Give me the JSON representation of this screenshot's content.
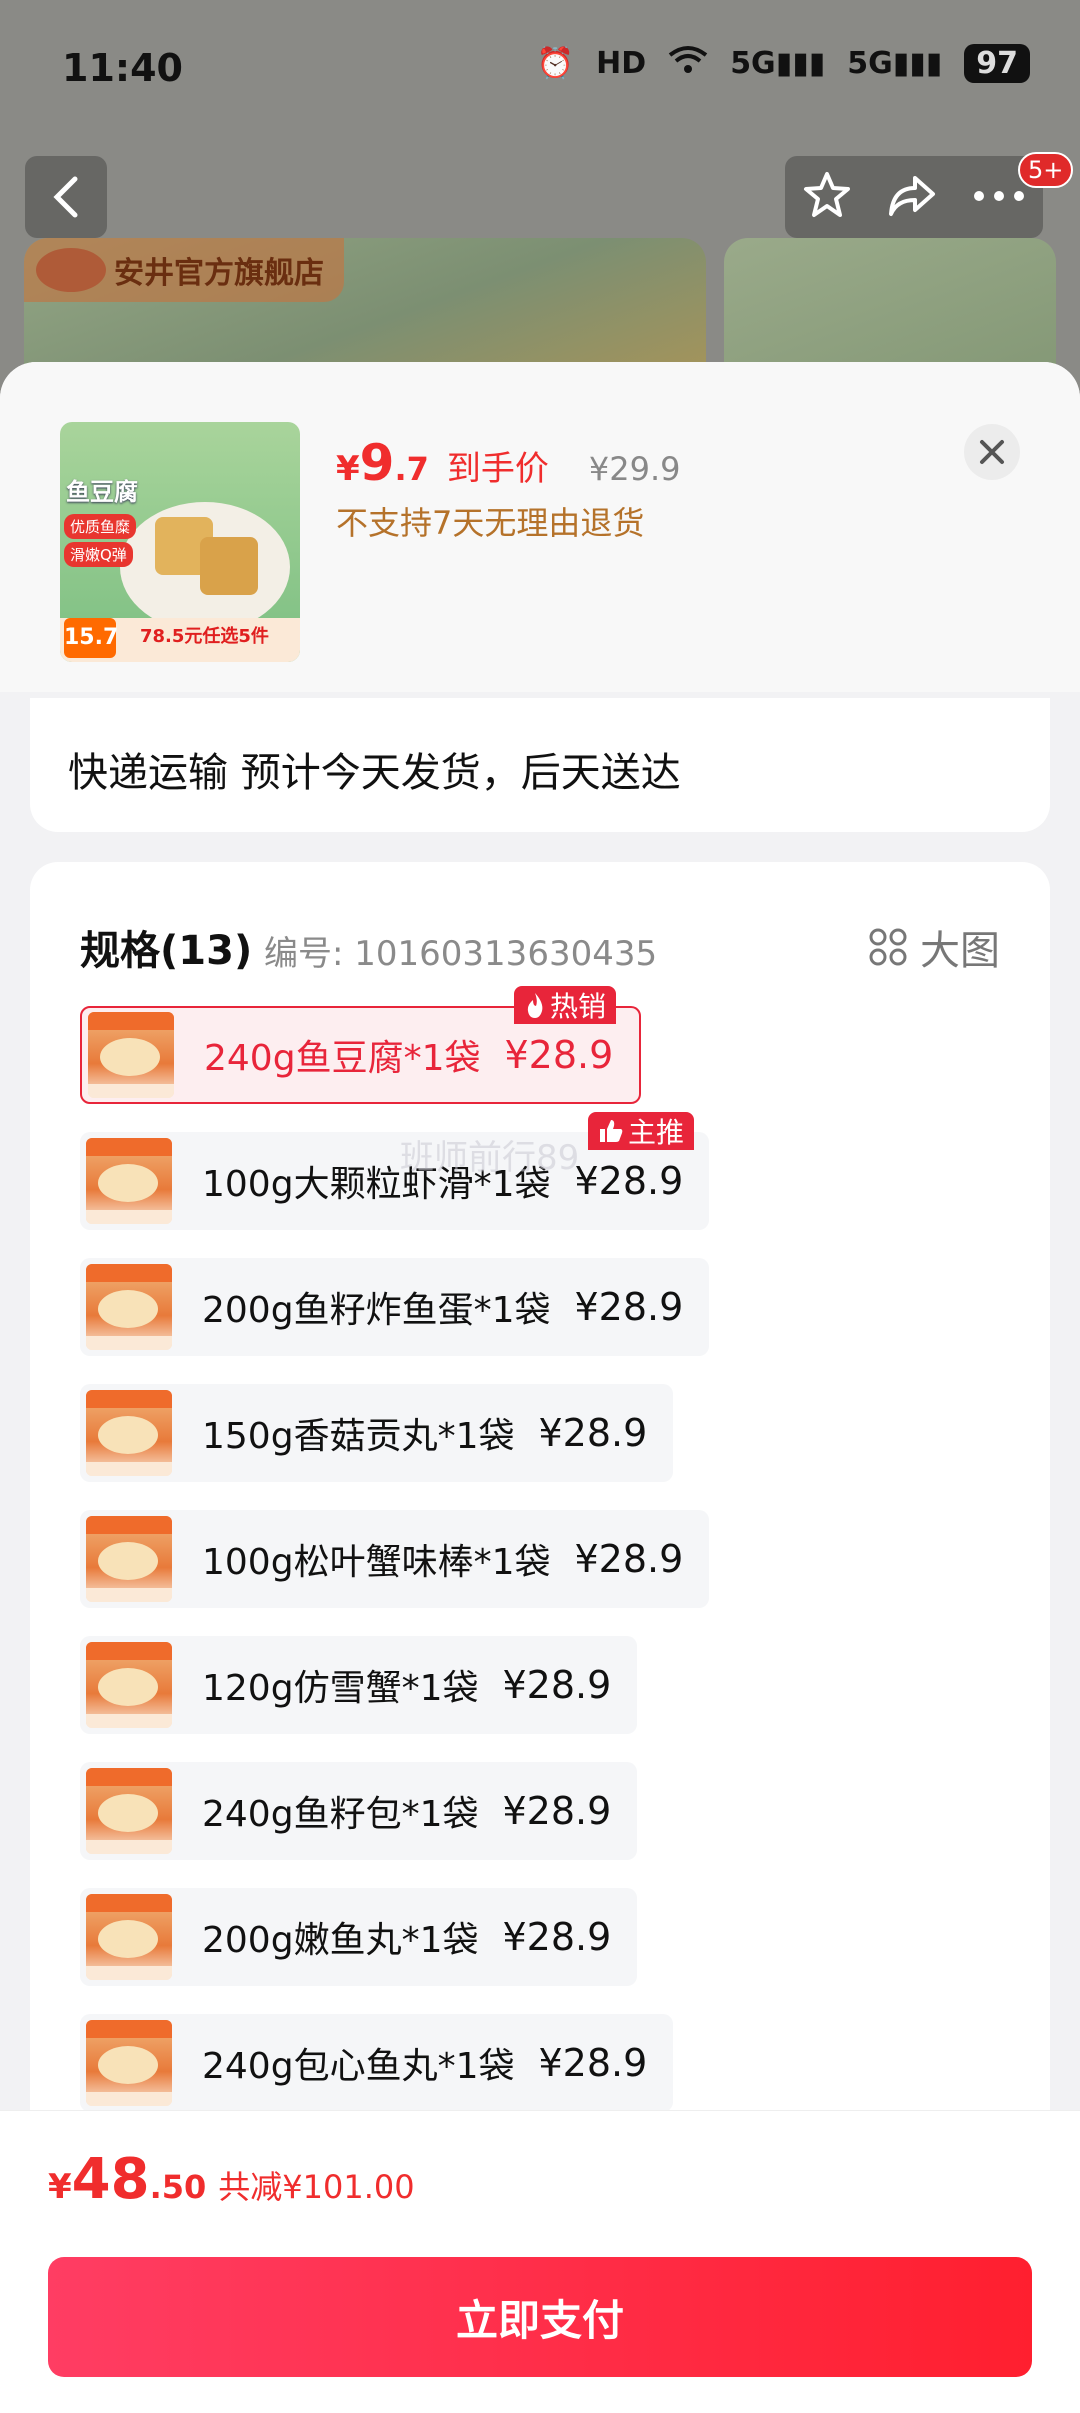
{
  "status_bar": {
    "time": "11:40",
    "network_1": "5G",
    "network_2": "5G",
    "battery": "97",
    "hd": "HD"
  },
  "nav": {
    "badge": "5+"
  },
  "banner": {
    "store_name": "安井官方旗舰店"
  },
  "product": {
    "thumb_title": "鱼豆腐",
    "thumb_tag_1": "优质鱼糜",
    "thumb_tag_2": "滑嫩Q弹",
    "thumb_price": "15.7",
    "thumb_promo": "78.5元任选5件",
    "price_currency": "¥",
    "price_int": "9",
    "price_dec": ".7",
    "price_label": "到手价",
    "original_price": "¥29.9",
    "return_note": "不支持7天无理由退货"
  },
  "shipping": {
    "text": "快递运输 预计今天发货，后天送达"
  },
  "spec": {
    "title": "规格(13)",
    "code": "编号: 10160313630435",
    "big_image_label": "大图",
    "items": [
      {
        "name": "240g鱼豆腐*1袋",
        "price": "¥28.9",
        "badge": "热销"
      },
      {
        "name": "100g大颗粒虾滑*1袋",
        "price": "¥28.9",
        "badge": "主推"
      },
      {
        "name": "200g鱼籽炸鱼蛋*1袋",
        "price": "¥28.9"
      },
      {
        "name": "150g香菇贡丸*1袋",
        "price": "¥28.9"
      },
      {
        "name": "100g松叶蟹味棒*1袋",
        "price": "¥28.9"
      },
      {
        "name": "120g仿雪蟹*1袋",
        "price": "¥28.9"
      },
      {
        "name": "240g鱼籽包*1袋",
        "price": "¥28.9"
      },
      {
        "name": "200g嫩鱼丸*1袋",
        "price": "¥28.9"
      },
      {
        "name": "240g包心鱼丸*1袋",
        "price": "¥28.9"
      }
    ]
  },
  "watermark": "班师前行89",
  "footer": {
    "total_currency": "¥",
    "total_int": "48",
    "total_dec": ".50",
    "discount": "共减¥101.00",
    "pay_label": "立即支付"
  }
}
